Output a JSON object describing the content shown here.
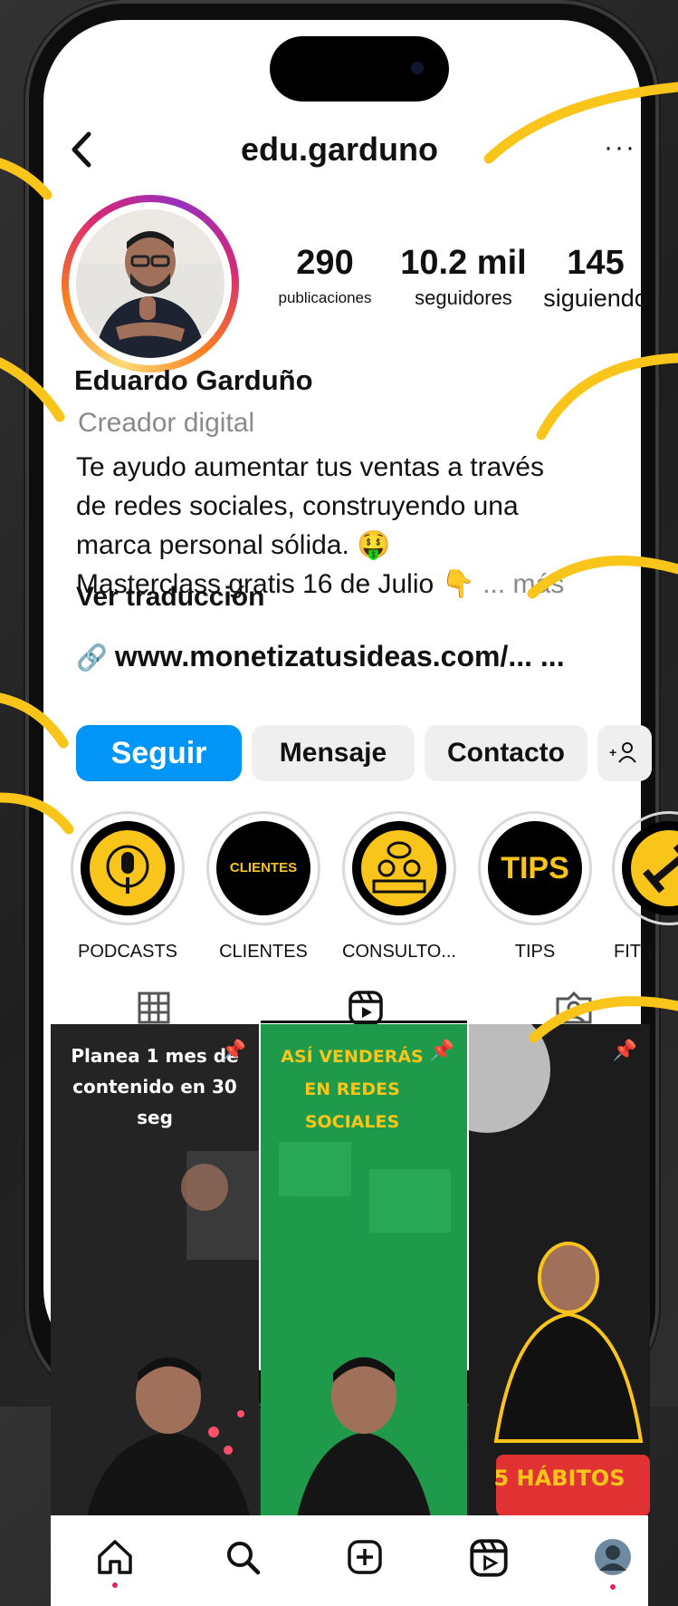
{
  "header": {
    "back_glyph": "‹",
    "username": "edu.garduno",
    "more_glyph": "···"
  },
  "stats": [
    {
      "value": "290",
      "label": "publicaciones"
    },
    {
      "value": "10.2 mil",
      "label": "seguidores"
    },
    {
      "value": "145",
      "label": "siguiendo"
    }
  ],
  "profile": {
    "name": "Eduardo Garduño",
    "category": "Creador digital",
    "bio_line1": "Te ayudo aumentar tus ventas a través",
    "bio_line2": "de redes sociales, construyendo una",
    "bio_line3": "marca personal sólida. 🤑",
    "bio_line4": "Masterclass gratis 16 de Julio 👇",
    "more": "... más",
    "translate": "Ver traducción",
    "link": "www.monetizatusideas.com/... ..."
  },
  "actions": {
    "follow": "Seguir",
    "message": "Mensaje",
    "contact": "Contacto",
    "add_user": "+☺"
  },
  "highlights": [
    {
      "label": "PODCASTS",
      "icon": "podcast-mic-icon"
    },
    {
      "label": "CLIENTES",
      "icon_text": "CLIENTES"
    },
    {
      "label": "CONSULTO...",
      "icon": "consulting-icon"
    },
    {
      "label": "TIPS",
      "icon_text": "TIPS"
    },
    {
      "label": "FITN",
      "icon": "fitness-dumbbell-icon"
    }
  ],
  "tabs": [
    "grid",
    "reels",
    "tagged"
  ],
  "posts": [
    {
      "title": "Planea 1 mes de contenido en 30 seg"
    },
    {
      "title": "ASÍ VENDERÁS EN REDES SOCIALES"
    },
    {
      "title": "5 HÁBITOS"
    }
  ],
  "bottom_nav": [
    "home",
    "search",
    "create",
    "reels",
    "profile"
  ],
  "colors": {
    "accent": "#0095f6",
    "annotation": "#f9c51a",
    "highlight_bg": "#f9c51a"
  }
}
